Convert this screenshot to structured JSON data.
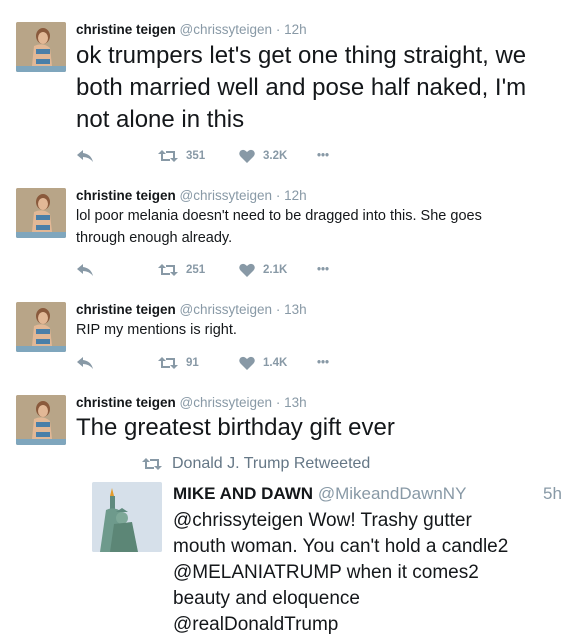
{
  "tweets": [
    {
      "name": "christine teigen",
      "handle": "@chrissyteigen",
      "separator": "·",
      "time": "12h",
      "text_lines": [
        "ok trumpers let's get one thing straight, we",
        "both married well and pose half naked, I'm",
        "not alone in this"
      ],
      "retweets": "351",
      "likes": "3.2K",
      "more": "•••"
    },
    {
      "name": "christine teigen",
      "handle": "@chrissyteigen",
      "separator": "·",
      "time": "12h",
      "text_lines": [
        "lol poor melania doesn't need to be dragged into this. She goes",
        "through enough already."
      ],
      "retweets": "251",
      "likes": "2.1K",
      "more": "•••"
    },
    {
      "name": "christine teigen",
      "handle": "@chrissyteigen",
      "separator": "·",
      "time": "13h",
      "text_lines": [
        "RIP my mentions is right."
      ],
      "retweets": "91",
      "likes": "1.4K",
      "more": "•••"
    },
    {
      "name": "christine teigen",
      "handle": "@chrissyteigen",
      "separator": "·",
      "time": "13h",
      "text_lines": [
        "The greatest birthday gift ever"
      ]
    }
  ],
  "retweeted_by": "Donald J. Trump Retweeted",
  "embedded": {
    "name": "MIKE AND DAWN",
    "handle": "@MikeandDawnNY",
    "time": "5h",
    "text_lines": [
      "@chrissyteigen Wow! Trashy gutter",
      "mouth woman. You can't hold a candle2",
      "@MELANIATRUMP when it comes2",
      "beauty and eloquence",
      "@realDonaldTrump"
    ]
  },
  "colors": {
    "muted": "#8899a6",
    "text": "#14171a",
    "border": "#e6ecf0"
  },
  "icons": [
    "reply-icon",
    "retweet-icon",
    "like-icon",
    "more-icon",
    "statue-of-liberty-avatar",
    "profile-photo-avatar"
  ]
}
